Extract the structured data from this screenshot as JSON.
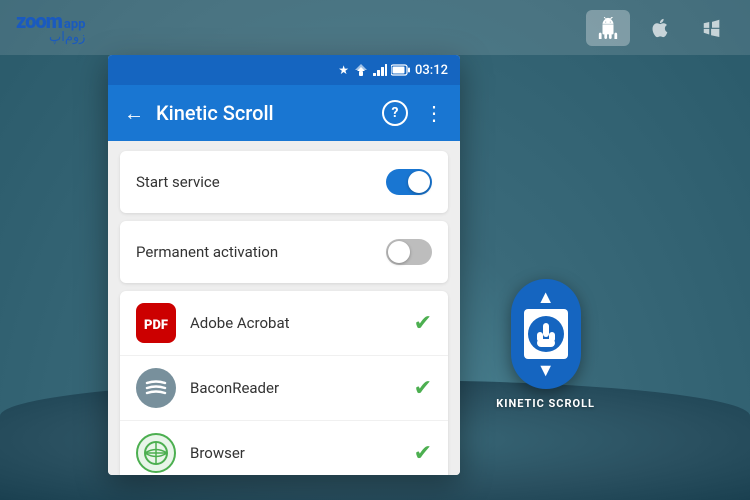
{
  "topBar": {
    "logoZoom": "zoom",
    "logoApp": "app",
    "logoArabic": "زوم‌اپ",
    "platforms": [
      {
        "id": "android",
        "icon": "🤖",
        "active": true
      },
      {
        "id": "apple",
        "icon": "",
        "active": false
      },
      {
        "id": "windows",
        "icon": "⊞",
        "active": false
      }
    ]
  },
  "statusBar": {
    "star": "★",
    "signals": "▼◀",
    "battery": "⬛",
    "time": "03:12"
  },
  "appHeader": {
    "backIcon": "←",
    "title": "Kinetic Scroll",
    "helpIcon": "?",
    "menuIcon": "⋮"
  },
  "toggleItems": [
    {
      "id": "start-service",
      "label": "Start service",
      "state": "on"
    },
    {
      "id": "permanent-activation",
      "label": "Permanent activation",
      "state": "off"
    }
  ],
  "appList": [
    {
      "id": "adobe-acrobat",
      "name": "Adobe Acrobat",
      "iconType": "acrobat",
      "iconText": "PDF",
      "checked": true
    },
    {
      "id": "bacon-reader",
      "name": "BaconReader",
      "iconType": "bacon",
      "iconText": "≋",
      "checked": true
    },
    {
      "id": "browser",
      "name": "Browser",
      "iconType": "browser",
      "iconText": "↺",
      "checked": true
    }
  ],
  "kineticWidget": {
    "upArrow": "▲",
    "downArrow": "▼",
    "handIcon": "☜",
    "label": "KINETIC SCROLL"
  }
}
